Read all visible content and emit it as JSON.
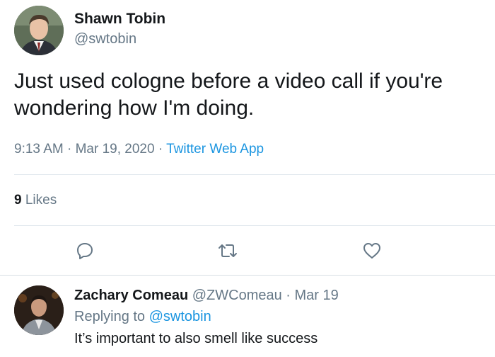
{
  "tweet": {
    "author_name": "Shawn Tobin",
    "author_handle": "@swtobin",
    "text": "Just used cologne before a video call if you're wondering how I'm doing.",
    "time": "9:13 AM",
    "sep1": " · ",
    "date": "Mar 19, 2020",
    "sep2": " · ",
    "source": "Twitter Web App",
    "likes_count": "9",
    "likes_label": " Likes"
  },
  "reply": {
    "author_name": "Zachary Comeau",
    "author_handle": " @ZWComeau",
    "dot": " · ",
    "date": "Mar 19",
    "replying_label": "Replying to ",
    "replying_mention": "@swtobin",
    "text": "It’s important to also smell like success"
  },
  "icons": {
    "reply": "reply-icon",
    "retweet": "retweet-icon",
    "like": "like-icon"
  },
  "colors": {
    "text": "#14171a",
    "secondary": "#657786",
    "link": "#1b95e0",
    "divider": "#e1e8ed"
  }
}
